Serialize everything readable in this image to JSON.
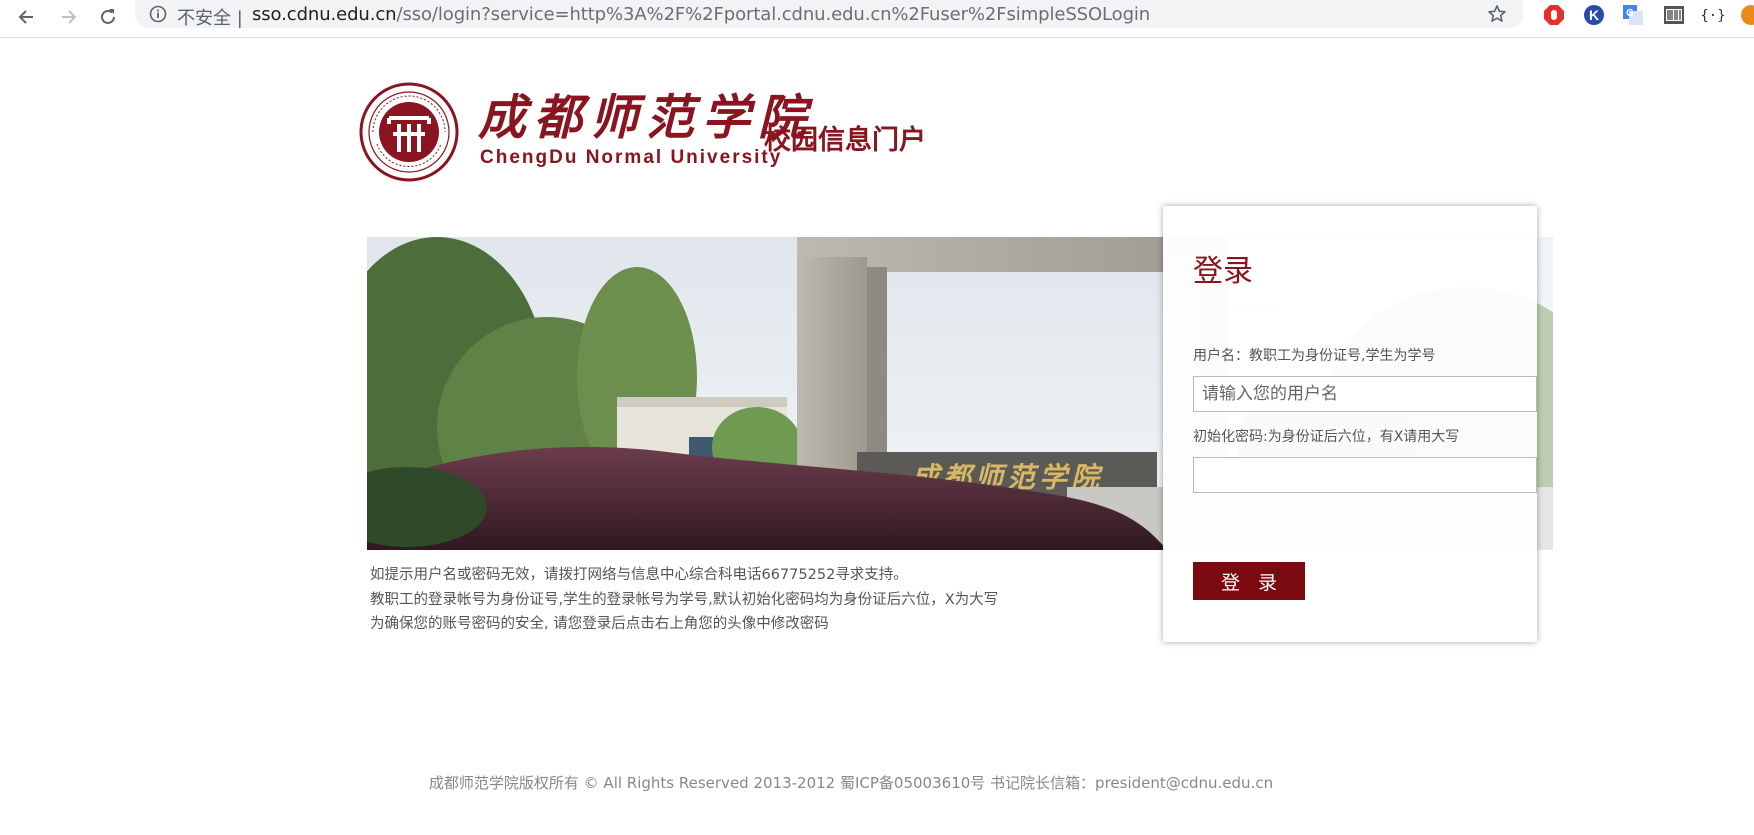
{
  "browser": {
    "security_label": "不安全 |",
    "url_host": "sso.cdnu.edu.cn",
    "url_path": "/sso/login?service=http%3A%2F%2Fportal.cdnu.edu.cn%2Fuser%2FsimpleSSOLogin",
    "extensions": [
      "adblock-icon",
      "k-extension-icon",
      "translate-icon",
      "barcode-icon",
      "json-viewer-icon",
      "extension-icon"
    ]
  },
  "header": {
    "logo_cn": "成都师范学院",
    "logo_en": "ChengDu Normal University",
    "portal_title": "校园信息门户"
  },
  "banner": {
    "gate_text": "成都师范学院"
  },
  "login": {
    "title": "登录",
    "username_label": "用户名：教职工为身份证号,学生为学号",
    "username_placeholder": "请输入您的用户名",
    "password_label": "初始化密码:为身份证后六位，有X请用大写",
    "password_value": "",
    "button_label": "登 录"
  },
  "notice": {
    "lines": [
      "如提示用户名或密码无效，请拨打网络与信息中心综合科电话66775252寻求支持。",
      "教职工的登录帐号为身份证号,学生的登录帐号为学号,默认初始化密码均为身份证后六位，X为大写",
      "为确保您的账号密码的安全, 请您登录后点击右上角您的头像中修改密码"
    ]
  },
  "footer": {
    "text": "成都师范学院版权所有 © All Rights Reserved 2013-2012 蜀ICP备05003610号 书记院长信箱：president@cdnu.edu.cn"
  },
  "colors": {
    "brand": "#8a1420",
    "button": "#7a0a10"
  }
}
